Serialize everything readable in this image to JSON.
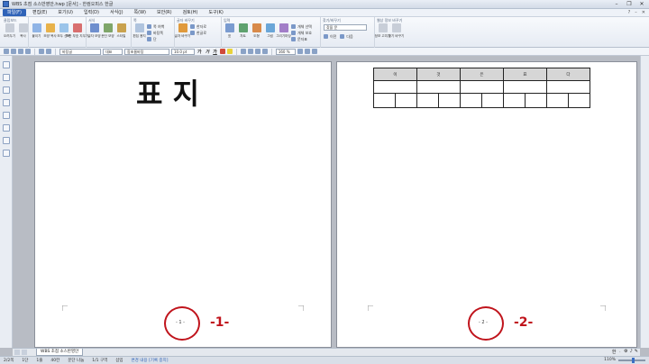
{
  "window": {
    "title": "WBS 초점 소스반영안.hwp [문서] - 한컴오피스 한글",
    "controls": [
      "–",
      "❐",
      "✕"
    ]
  },
  "menubar": {
    "items": [
      "파일(F)",
      "편집(E)",
      "보기(U)",
      "입력(D)",
      "서식(J)",
      "쪽(W)",
      "보안(R)",
      "검토(H)",
      "도구(K)"
    ],
    "active_index": 0,
    "right": [
      "?",
      "–",
      "✕"
    ]
  },
  "ribbon": {
    "groups": [
      {
        "label": "클립보드",
        "buttons": [
          {
            "label": "오려두기",
            "color": "#c8ced8"
          },
          {
            "label": "복사",
            "color": "#c8ced8"
          }
        ]
      },
      {
        "label": "",
        "buttons": [
          {
            "label": "붙이기",
            "color": "#8fb4e6"
          },
          {
            "label": "모양 복사",
            "color": "#e8b24a"
          },
          {
            "label": "모두 선택",
            "color": "#9bc4ea"
          },
          {
            "label": "조판 부호 지우기",
            "color": "#d86f6f"
          }
        ]
      },
      {
        "label": "서식",
        "buttons": [
          {
            "label": "글자 모양",
            "color": "#6f8fce"
          },
          {
            "label": "문단 모양",
            "color": "#7fa66a"
          },
          {
            "label": "스타일",
            "color": "#c9a24e"
          }
        ]
      },
      {
        "label": "쪽",
        "buttons": [
          {
            "label": "편집 용지",
            "color": "#b0c4de"
          }
        ],
        "mini": [
          "쪽 여백",
          "바탕쪽",
          "단"
        ]
      },
      {
        "label": "글자 바꾸기",
        "buttons": [
          {
            "label": "글자 바꾸기",
            "color": "#e09a3c"
          }
        ],
        "mini": [
          "한자로",
          "한글로"
        ]
      },
      {
        "label": "입력",
        "buttons": [
          {
            "label": "표",
            "color": "#7a9bd0"
          },
          {
            "label": "차트",
            "color": "#5fa26f"
          },
          {
            "label": "도형",
            "color": "#d88a4a"
          },
          {
            "label": "그림",
            "color": "#6aa6d8"
          },
          {
            "label": "그리기마당",
            "color": "#a27ec8"
          }
        ],
        "mini": [
          "개체 선택",
          "개체 보호",
          "문자표"
        ]
      },
      {
        "label": "찾기/바꾸기",
        "select": "찾을 문",
        "mini": [
          "이전",
          "다음"
        ]
      },
      {
        "label": "웹상 정보 바꾸기",
        "buttons": [
          {
            "label": "정보 고치기",
            "color": "#c8ced8"
          },
          {
            "label": "찾기 바꾸기",
            "color": "#c8ced8"
          }
        ]
      }
    ]
  },
  "formatbar": {
    "style_select": "바탕글",
    "lang_select": "대표",
    "font_select": "함초롬바탕",
    "size_select": "10.0 pt",
    "format_buttons": [
      "가",
      "가",
      "가"
    ],
    "zoom_select": "160 %"
  },
  "page1": {
    "title": "표   지",
    "page_number": "- 1 -",
    "annotation": "-1-"
  },
  "page2": {
    "table_header": [
      "이",
      "것",
      "은",
      "표",
      "다"
    ],
    "table_row_cells": 10,
    "page_number": "- 2 -",
    "annotation": "-2-"
  },
  "doc_tab": {
    "label": "WBS 초점 소스반영안"
  },
  "tray": [
    "한",
    "ㆍ",
    "⚙",
    "♪",
    "✎"
  ],
  "statusbar": {
    "items": [
      "2/2쪽",
      "1단",
      "1줄",
      "40칸",
      "문단 나눔",
      "1/1 구역",
      "삽입",
      "변경 내용 [기록 중지]"
    ],
    "zoom": "110%",
    "zoom_level": 0.55
  },
  "colors": {
    "accent": "#2f63b8",
    "annotation": "#c0141c"
  }
}
